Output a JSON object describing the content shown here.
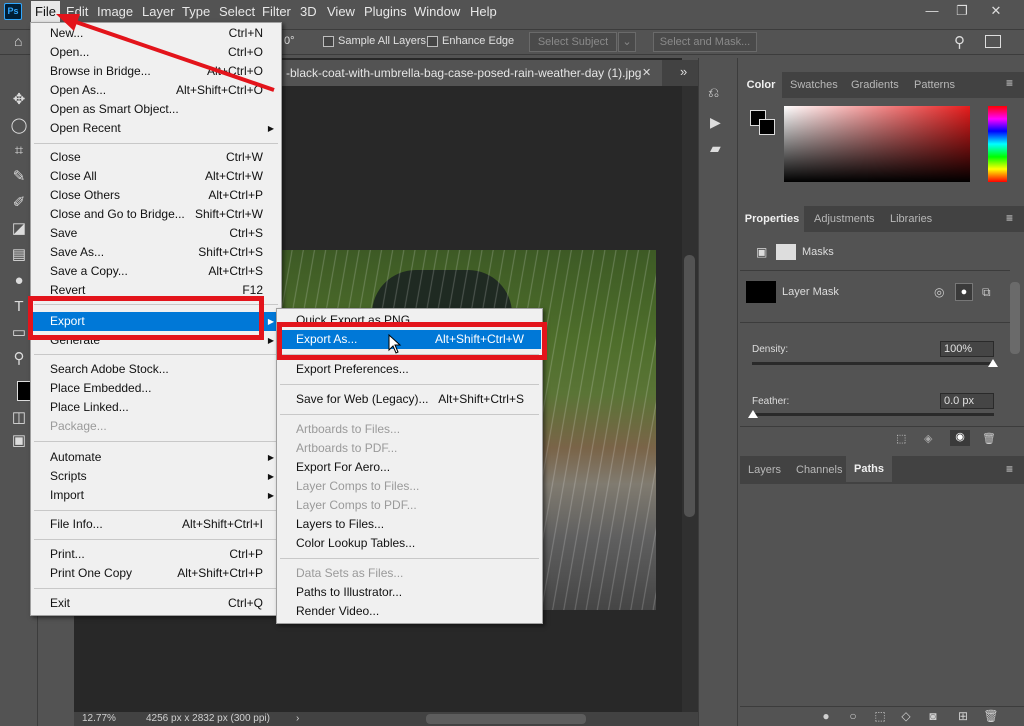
{
  "app": {
    "logo": "Ps"
  },
  "menubar": {
    "items": [
      "File",
      "Edit",
      "Image",
      "Layer",
      "Type",
      "Select",
      "Filter",
      "3D",
      "View",
      "Plugins",
      "Window",
      "Help"
    ]
  },
  "window_controls": {
    "minimize": "—",
    "restore": "❐",
    "close": "✕"
  },
  "options_bar": {
    "angle": "0°",
    "sample_all_layers": "Sample All Layers",
    "enhance_edge": "Enhance Edge",
    "select_subject": "Select Subject",
    "select_and_mask": "Select and Mask..."
  },
  "document": {
    "tab_title": "-black-coat-with-umbrella-bag-case-posed-rain-weather-day (1).jpg",
    "tab_close": "✕",
    "zoom": "12.77%",
    "info": "4256 px x 2832 px (300 ppi)"
  },
  "file_menu": {
    "items": [
      {
        "label": "New...",
        "shortcut": "Ctrl+N"
      },
      {
        "label": "Open...",
        "shortcut": "Ctrl+O"
      },
      {
        "label": "Browse in Bridge...",
        "shortcut": "Alt+Ctrl+O"
      },
      {
        "label": "Open As...",
        "shortcut": "Alt+Shift+Ctrl+O"
      },
      {
        "label": "Open as Smart Object...",
        "shortcut": ""
      },
      {
        "label": "Open Recent",
        "shortcut": ""
      },
      {
        "label": "Close",
        "shortcut": "Ctrl+W"
      },
      {
        "label": "Close All",
        "shortcut": "Alt+Ctrl+W"
      },
      {
        "label": "Close Others",
        "shortcut": "Alt+Ctrl+P"
      },
      {
        "label": "Close and Go to Bridge...",
        "shortcut": "Shift+Ctrl+W"
      },
      {
        "label": "Save",
        "shortcut": "Ctrl+S"
      },
      {
        "label": "Save As...",
        "shortcut": "Shift+Ctrl+S"
      },
      {
        "label": "Save a Copy...",
        "shortcut": "Alt+Ctrl+S"
      },
      {
        "label": "Revert",
        "shortcut": "F12"
      },
      {
        "label": "Export",
        "shortcut": ""
      },
      {
        "label": "Generate",
        "shortcut": ""
      },
      {
        "label": "Search Adobe Stock...",
        "shortcut": ""
      },
      {
        "label": "Place Embedded...",
        "shortcut": ""
      },
      {
        "label": "Place Linked...",
        "shortcut": ""
      },
      {
        "label": "Package...",
        "shortcut": ""
      },
      {
        "label": "Automate",
        "shortcut": ""
      },
      {
        "label": "Scripts",
        "shortcut": ""
      },
      {
        "label": "Import",
        "shortcut": ""
      },
      {
        "label": "File Info...",
        "shortcut": "Alt+Shift+Ctrl+I"
      },
      {
        "label": "Print...",
        "shortcut": "Ctrl+P"
      },
      {
        "label": "Print One Copy",
        "shortcut": "Alt+Shift+Ctrl+P"
      },
      {
        "label": "Exit",
        "shortcut": "Ctrl+Q"
      }
    ]
  },
  "export_submenu": {
    "items": [
      {
        "label": "Quick Export as PNG",
        "shortcut": ""
      },
      {
        "label": "Export As...",
        "shortcut": "Alt+Shift+Ctrl+W"
      },
      {
        "label": "Export Preferences...",
        "shortcut": ""
      },
      {
        "label": "Save for Web (Legacy)...",
        "shortcut": "Alt+Shift+Ctrl+S"
      },
      {
        "label": "Artboards to Files...",
        "shortcut": ""
      },
      {
        "label": "Artboards to PDF...",
        "shortcut": ""
      },
      {
        "label": "Export For Aero...",
        "shortcut": ""
      },
      {
        "label": "Layer Comps to Files...",
        "shortcut": ""
      },
      {
        "label": "Layer Comps to PDF...",
        "shortcut": ""
      },
      {
        "label": "Layers to Files...",
        "shortcut": ""
      },
      {
        "label": "Color Lookup Tables...",
        "shortcut": ""
      },
      {
        "label": "Data Sets as Files...",
        "shortcut": ""
      },
      {
        "label": "Paths to Illustrator...",
        "shortcut": ""
      },
      {
        "label": "Render Video...",
        "shortcut": ""
      }
    ]
  },
  "color_panel": {
    "tabs": [
      "Color",
      "Swatches",
      "Gradients",
      "Patterns"
    ]
  },
  "properties_panel": {
    "tabs": [
      "Properties",
      "Adjustments",
      "Libraries"
    ],
    "masks_label": "Masks",
    "layer_mask_label": "Layer Mask",
    "density_label": "Density:",
    "density_value": "100%",
    "feather_label": "Feather:",
    "feather_value": "0.0 px"
  },
  "layers_panel": {
    "tabs": [
      "Layers",
      "Channels",
      "Paths"
    ]
  },
  "colors": {
    "accent": "#0078d7",
    "highlight": "#e3141b",
    "panel": "#535353"
  }
}
